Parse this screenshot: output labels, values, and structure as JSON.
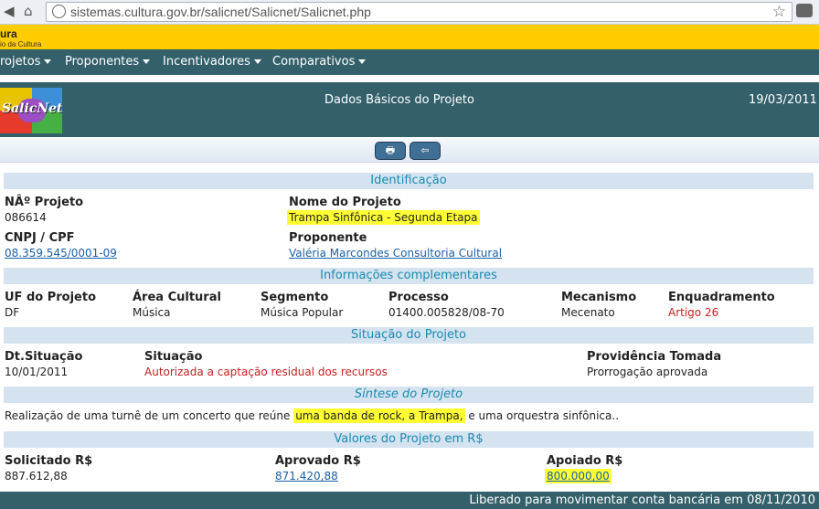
{
  "browser": {
    "url": "sistemas.cultura.gov.br/salicnet/Salicnet/Salicnet.php",
    "back_glyph": "◀",
    "home_glyph": "⌂",
    "star_glyph": "☆"
  },
  "header": {
    "brand": "ura",
    "subtitle": "io da Cultura"
  },
  "menu": {
    "items": [
      {
        "label": "rojetos"
      },
      {
        "label": "Proponentes"
      },
      {
        "label": "Incentivadores"
      },
      {
        "label": "Comparativos"
      }
    ]
  },
  "titlebar": {
    "logo_text": "SalicNet",
    "title": "Dados Básicos do Projeto",
    "date": "19/03/2011"
  },
  "toolbar": {
    "print_glyph": "🖶",
    "back_glyph": "⇦"
  },
  "identificacao": {
    "header": "Identificação",
    "num_label": "NÂº Projeto",
    "num_value": "086614",
    "nome_label": "Nome do Projeto",
    "nome_value": "Trampa Sinfônica - Segunda Etapa",
    "cnpj_label": "CNPJ / CPF",
    "cnpj_value": "08.359.545/0001-09",
    "proponente_label": "Proponente",
    "proponente_value": "Valéria Marcondes Consultoria Cultural"
  },
  "complementares": {
    "header": "Informações complementares",
    "fields": [
      {
        "label": "UF do Projeto",
        "value": "DF"
      },
      {
        "label": "Área Cultural",
        "value": "Música"
      },
      {
        "label": "Segmento",
        "value": "Música Popular"
      },
      {
        "label": "Processo",
        "value": "01400.005828/08-70"
      },
      {
        "label": "Mecanismo",
        "value": "Mecenato"
      },
      {
        "label": "Enquadramento",
        "value": "Artigo 26"
      }
    ]
  },
  "situacao": {
    "header": "Situação do Projeto",
    "dt_label": "Dt.Situação",
    "dt_value": "10/01/2011",
    "sit_label": "Situação",
    "sit_value": "Autorizada a captação residual dos recursos",
    "prov_label": "Providência Tomada",
    "prov_value": "Prorrogação aprovada"
  },
  "sintese": {
    "header": "Síntese do Projeto",
    "text_before": "Realização de uma turnê de um concerto que reúne ",
    "text_highlight": "uma banda de rock, a Trampa,",
    "text_after": " e uma orquestra sinfônica.."
  },
  "valores": {
    "header": "Valores do Projeto em R$",
    "solicitado_label": "Solicitado R$",
    "solicitado_value": "887.612,88",
    "aprovado_label": "Aprovado R$",
    "aprovado_value": "871.420,88",
    "apoiado_label": "Apoiado R$",
    "apoiado_value": "800.000,00"
  },
  "footer": {
    "text": "Liberado para movimentar conta bancária em 08/11/2010"
  },
  "colors": {
    "teal": "#33606b",
    "yellow": "#ffcc00",
    "section_bg": "#d4e3ef",
    "section_text": "#1a8ab0",
    "highlight": "#ffff33",
    "link": "#1a5fa8",
    "red": "#c41e1e"
  }
}
